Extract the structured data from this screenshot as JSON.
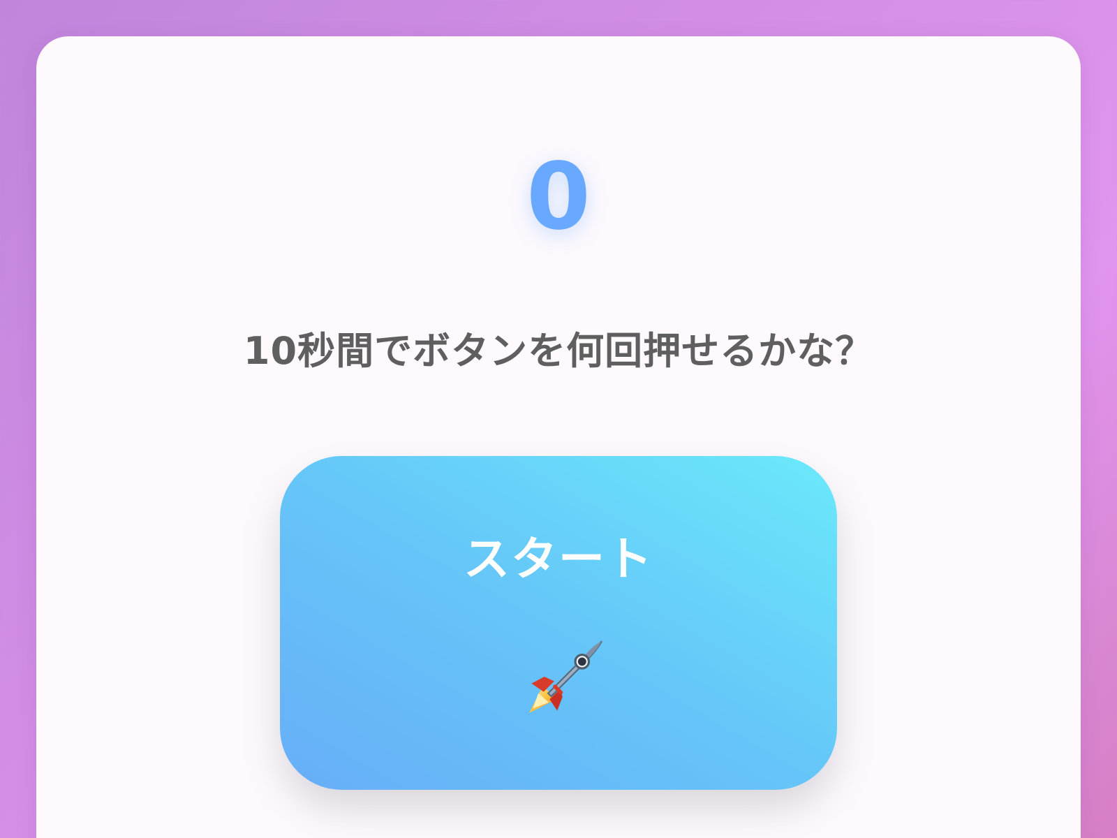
{
  "score": "0",
  "subtitle": "10秒間でボタンを何回押せるかな？",
  "button": {
    "label": "スタート",
    "icon": "rocket-icon"
  },
  "colors": {
    "score": "#69a8ff",
    "button_gradient_start": "#67aef8",
    "button_gradient_end": "#6ae9fb",
    "subtitle": "#5f5f5f",
    "background_start": "#c185dc",
    "background_end": "#e095ee"
  }
}
